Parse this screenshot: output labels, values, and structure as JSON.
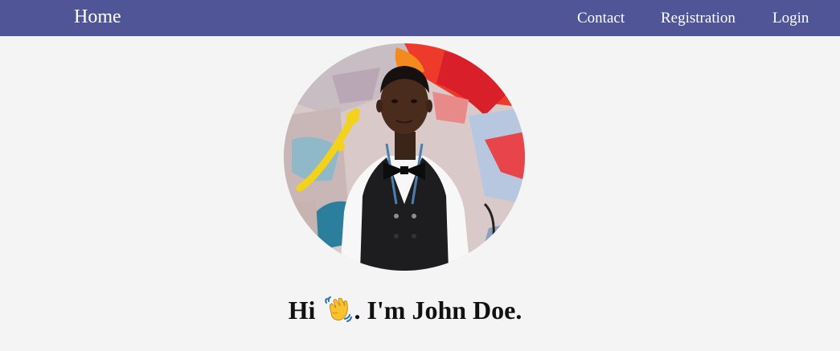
{
  "navbar": {
    "brand": "Home",
    "links": [
      {
        "label": "Contact"
      },
      {
        "label": "Registration"
      },
      {
        "label": "Login"
      }
    ],
    "background_color": "#4f5597"
  },
  "hero": {
    "avatar_icon": "profile-photo",
    "greeting_prefix": "Hi",
    "wave_icon": "waving-hand-icon",
    "greeting_suffix": ". I'm John Doe."
  }
}
